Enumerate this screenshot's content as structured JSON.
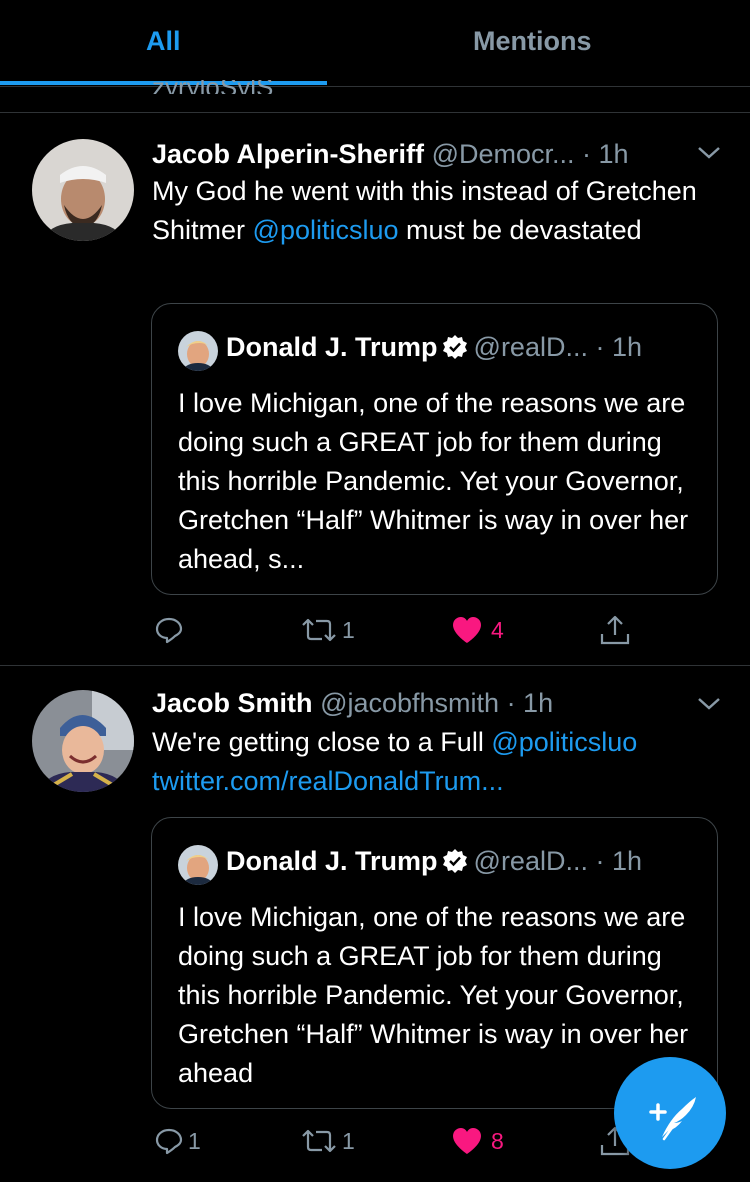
{
  "tabs": {
    "all": "All",
    "mentions": "Mentions"
  },
  "cut_text": "zyryloSylS",
  "tweets": [
    {
      "name": "Jacob Alperin-Sheriff",
      "handle": "@Democr...",
      "time": "· 1h",
      "text_before": "My God he went with this instead of Gretchen Shitmer ",
      "mention": "@politicsluo",
      "text_after": " must be devastated",
      "quote": {
        "name": "Donald J. Trump",
        "handle": "@realD...",
        "time": "· 1h",
        "text": "I love Michigan, one of the reasons we are doing such a GREAT job for them during this horrible Pandemic. Yet your Governor, Gretchen “Half” Whitmer is way in over her ahead, s..."
      },
      "replies": "",
      "retweets": "1",
      "likes": "4"
    },
    {
      "name": "Jacob Smith",
      "handle": "@jacobfhsmith",
      "time": "· 1h",
      "text_before": "We're getting close to a Full ",
      "mention": "@politicsluo",
      "link": "twitter.com/realDonaldTrum...",
      "quote": {
        "name": "Donald J. Trump",
        "handle": "@realD...",
        "time": "· 1h",
        "text": "I love Michigan, one of the reasons we are doing such a GREAT job for them during this horrible Pandemic. Yet your Governor, Gretchen “Half” Whitmer is way in over her ahead"
      },
      "replies": "1",
      "retweets": "1",
      "likes": "8"
    }
  ],
  "icons": {
    "reply": "reply-icon",
    "retweet": "retweet-icon",
    "like": "heart-icon",
    "share": "share-icon",
    "compose": "compose-tweet-icon",
    "verified": "verified-badge-icon",
    "chevron": "chevron-down-icon"
  },
  "colors": {
    "accent": "#1d9bf0",
    "like": "#f91880",
    "secondary_text": "#8899a6",
    "background": "#000000"
  }
}
